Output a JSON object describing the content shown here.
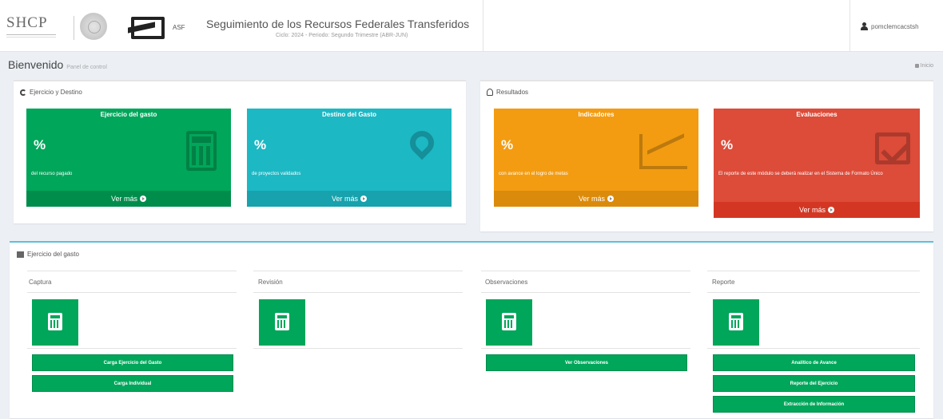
{
  "header": {
    "logo_text": "SHCP",
    "partner_label": "ASF",
    "title": "Seguimiento de los Recursos Federales Transferidos",
    "subtitle": "Ciclo: 2024 - Periodo: Segundo Trimestre (ABR-JUN)",
    "user_name": "pomclemcacstsh"
  },
  "page": {
    "title": "Bienvenido",
    "subtitle": "Panel de control",
    "breadcrumb": "Inicio"
  },
  "ejercicio_destino": {
    "title": "Ejercicio y Destino",
    "cards": [
      {
        "header": "Ejercicio del gasto",
        "value": "%",
        "desc": "del recurso pagado",
        "link": "Ver más"
      },
      {
        "header": "Destino del Gasto",
        "value": "%",
        "desc": "de proyectos validados",
        "link": "Ver más"
      }
    ]
  },
  "resultados": {
    "title": "Resultados",
    "cards": [
      {
        "header": "Indicadores",
        "value": "%",
        "desc": "con avance en el logro de metas",
        "link": "Ver más"
      },
      {
        "header": "Evaluaciones",
        "value": "%",
        "desc": "El reporte de este módulo se deberá realizar en el Sistema de Formato Único",
        "link": "Ver más"
      }
    ]
  },
  "gasto": {
    "title": "Ejercicio del gasto",
    "columns": [
      {
        "title": "Captura",
        "buttons": [
          "Carga Ejercicio del Gasto",
          "Carga Individual"
        ]
      },
      {
        "title": "Revisión",
        "buttons": []
      },
      {
        "title": "Observaciones",
        "buttons": [
          "Ver Observaciones"
        ]
      },
      {
        "title": "Reporte",
        "buttons": [
          "Analítico de Avance",
          "Reporte del Ejercicio",
          "Extracción de Información"
        ]
      }
    ]
  },
  "colors": {
    "green": "#00a65a",
    "aqua": "#1cb8c4",
    "yellow": "#f39c12",
    "red": "#dd4b39"
  }
}
